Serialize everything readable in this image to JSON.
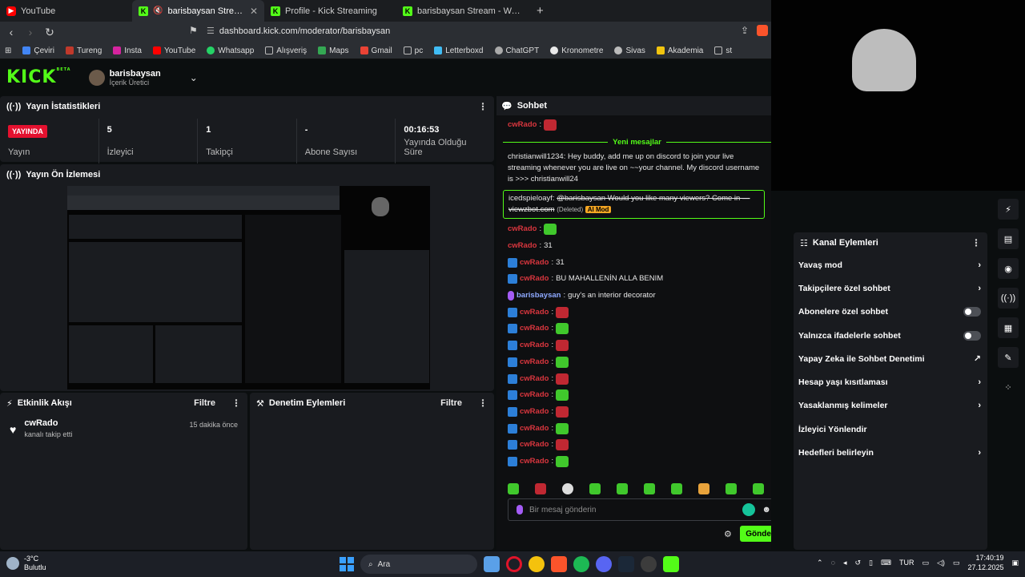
{
  "browser": {
    "tabs": [
      {
        "title": "YouTube",
        "icon": "youtube-icon"
      },
      {
        "title": "barisbaysan Stream - Kick Da",
        "icon": "kick-icon",
        "active": true
      },
      {
        "title": "Profile - Kick Streaming",
        "icon": "kick-icon"
      },
      {
        "title": "barisbaysan Stream - Watch Live on",
        "icon": "kick-icon"
      }
    ],
    "url": "dashboard.kick.com/moderator/barisbaysan",
    "bookmarks": [
      "Çeviri",
      "Tureng",
      "Insta",
      "YouTube",
      "Whatsapp",
      "Alışveriş",
      "Maps",
      "Gmail",
      "pc",
      "Letterboxd",
      "ChatGPT",
      "Kronometre",
      "Sivas",
      "Akademia",
      "st"
    ]
  },
  "header": {
    "logo": "KICK",
    "logo_sup": "BETA",
    "username": "barisbaysan",
    "role": "İçerik Üretici"
  },
  "stats_panel": {
    "title": "Yayın İstatistikleri",
    "live_badge": "YAYINDA",
    "items": [
      {
        "value": "",
        "label": "Yayın"
      },
      {
        "value": "5",
        "label": "İzleyici"
      },
      {
        "value": "1",
        "label": "Takipçi"
      },
      {
        "value": "-",
        "label": "Abone Sayısı"
      },
      {
        "value": "00:16:53",
        "label": "Yayında Olduğu Süre"
      }
    ]
  },
  "preview_panel": {
    "title": "Yayın Ön İzlemesi"
  },
  "activity_panel": {
    "title": "Etkinlik Akışı",
    "filter": "Filtre",
    "events": [
      {
        "user": "cwRado",
        "desc": "kanalı takip etti",
        "time": "15 dakika önce"
      }
    ]
  },
  "mod_panel": {
    "title": "Denetim Eylemleri",
    "filter": "Filtre"
  },
  "chat": {
    "title": "Sohbet",
    "new_messages": "Yeni mesajlar",
    "top_user": "cwRado",
    "long_msg": {
      "user": "christianwill1234",
      "text": "Hey buddy, add me up on discord to join your live streaming whenever you are live on ~~your channel. My discord username is >>> christianwill24"
    },
    "mod_msg": {
      "user": "icedspieloayf",
      "text": "@barisbaysan Would you like many viewers? Come in — viewzbot.com",
      "deleted": "(Deleted)",
      "tag": "AI Mod"
    },
    "messages": [
      {
        "user": "cwRado",
        "text": "",
        "emote": "g",
        "badge": false
      },
      {
        "user": "cwRado",
        "text": "31",
        "badge": false
      },
      {
        "user": "cwRado",
        "text": "31",
        "badge": true
      },
      {
        "user": "cwRado",
        "text": "BU MAHALLENİN ALLA BENIM",
        "badge": true
      },
      {
        "user": "barisbaysan",
        "text": "guy's an interior decorator",
        "badge": "mic"
      },
      {
        "user": "cwRado",
        "emote": "r",
        "badge": true
      },
      {
        "user": "cwRado",
        "emote": "g",
        "badge": true
      },
      {
        "user": "cwRado",
        "emote": "r",
        "badge": true
      },
      {
        "user": "cwRado",
        "emote": "g",
        "badge": true
      },
      {
        "user": "cwRado",
        "emote": "r",
        "badge": true
      },
      {
        "user": "cwRado",
        "emote": "g",
        "badge": true
      },
      {
        "user": "cwRado",
        "emote": "r",
        "badge": true
      },
      {
        "user": "cwRado",
        "emote": "g",
        "badge": true
      },
      {
        "user": "cwRado",
        "emote": "r",
        "badge": true
      },
      {
        "user": "cwRado",
        "emote": "g",
        "badge": true
      }
    ],
    "input_placeholder": "Bir mesaj gönderin",
    "send_label": "Gönder"
  },
  "channel_actions": {
    "title": "Kanal Eylemleri",
    "items": [
      {
        "label": "Yavaş mod",
        "control": "arrow"
      },
      {
        "label": "Takipçilere özel sohbet",
        "control": "arrow"
      },
      {
        "label": "Abonelere özel sohbet",
        "control": "toggle"
      },
      {
        "label": "Yalnızca ifadelerle sohbet",
        "control": "toggle"
      },
      {
        "label": "Yapay Zeka ile Sohbet Denetimi",
        "control": "external"
      },
      {
        "label": "Hesap yaşı kısıtlaması",
        "control": "arrow"
      },
      {
        "label": "Yasaklanmış kelimeler",
        "control": "arrow"
      },
      {
        "label": "İzleyici Yönlendir",
        "control": "none"
      },
      {
        "label": "Hedefleri belirleyin",
        "control": "arrow"
      }
    ]
  },
  "taskbar": {
    "temp": "-3°C",
    "weather": "Bulutlu",
    "search": "Ara",
    "lang": "TUR",
    "time": "17:40:19",
    "date": "27.12.2025"
  },
  "colors": {
    "accent": "#53fc18",
    "live": "#e4112f",
    "panel": "#191b1f"
  }
}
